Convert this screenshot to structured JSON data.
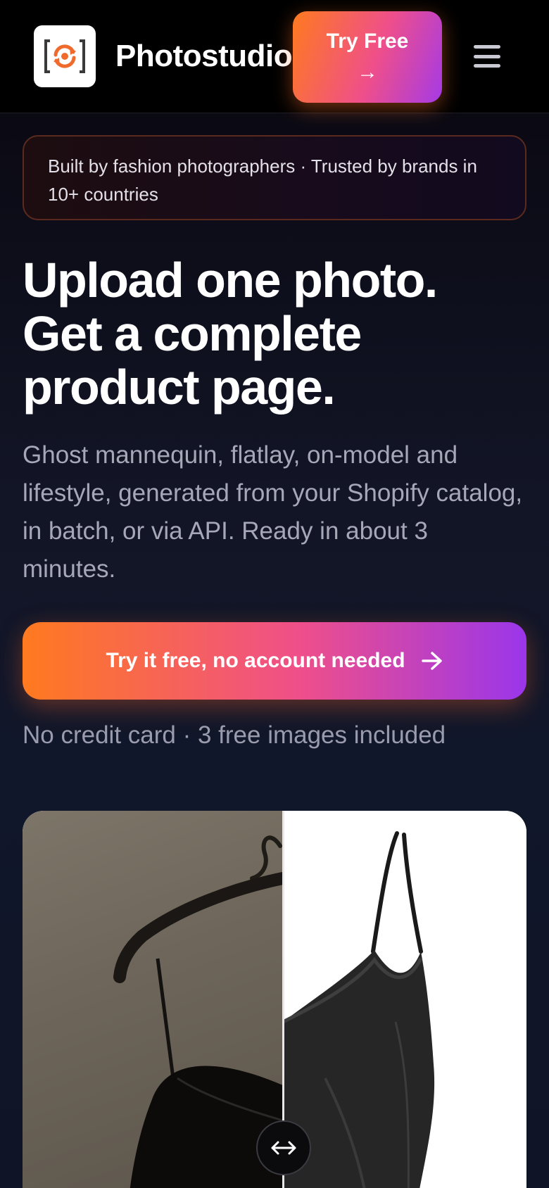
{
  "header": {
    "brand": "Photostudio",
    "try_button": "Try Free →",
    "logo_icon": "camera-refresh-icon",
    "menu_icon": "hamburger-menu-icon"
  },
  "badge": {
    "text": "Built by fashion photographers · Trusted by brands in 10+ countries"
  },
  "hero": {
    "headline": "Upload one photo. Get a complete product page.",
    "subtext": "Ghost mannequin, flatlay, on-model and lifestyle, generated from your Shopify catalog, in batch, or via API. Ready in about 3 minutes.",
    "cta_label": "Try it free, no account needed",
    "cta_icon": "arrow-right-icon",
    "note": "No credit card · 3 free images included"
  },
  "compare": {
    "before_label": "",
    "after_label": "",
    "handle_icon": "left-right-arrow-icon"
  },
  "colors": {
    "accent_start": "#ff7a1f",
    "accent_mid": "#ef4f8a",
    "accent_end": "#a53ae6",
    "background": "#0f1526"
  }
}
